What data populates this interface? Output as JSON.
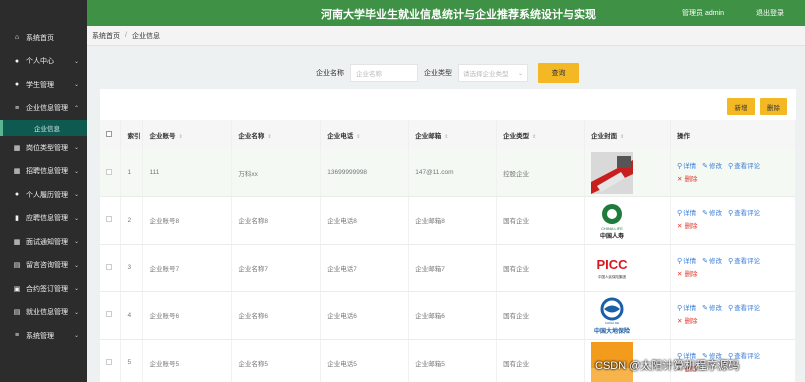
{
  "header": {
    "title": "河南大学毕业生就业信息统计与企业推荐系统设计与实现",
    "user": "管理员 admin",
    "logout": "退出登录",
    "color": "#3e9145"
  },
  "sidebar": {
    "items": [
      {
        "label": "系统首页",
        "icon": "home-icon"
      },
      {
        "label": "个人中心",
        "icon": "user-icon"
      },
      {
        "label": "学生管理",
        "icon": "user-icon"
      },
      {
        "label": "企业信息管理",
        "icon": "list-icon"
      },
      {
        "label": "岗位类型管理",
        "icon": "grid-icon"
      },
      {
        "label": "招聘信息管理",
        "icon": "grid-icon"
      },
      {
        "label": "个人履历管理",
        "icon": "user-icon"
      },
      {
        "label": "应聘信息管理",
        "icon": "bar-chart-icon"
      },
      {
        "label": "面试通知管理",
        "icon": "grid-icon"
      },
      {
        "label": "留言咨询管理",
        "icon": "document-icon"
      },
      {
        "label": "合约签订管理",
        "icon": "print-icon"
      },
      {
        "label": "就业信息管理",
        "icon": "document-icon"
      },
      {
        "label": "系统管理",
        "icon": "list-icon"
      }
    ],
    "sub_item": "企业信息"
  },
  "breadcrumb": {
    "home": "系统首页",
    "current": "企业信息"
  },
  "search": {
    "name_label": "企业名称",
    "name_placeholder": "企业名称",
    "type_label": "企业类型",
    "type_placeholder": "请选择企业类型",
    "query_button": "查询"
  },
  "actions": {
    "add": "新增",
    "delete": "删除"
  },
  "table": {
    "headers": [
      "索引",
      "企业账号",
      "企业名称",
      "企业电话",
      "企业邮箱",
      "企业类型",
      "企业封面",
      "操作"
    ],
    "rows": [
      {
        "index": "1",
        "account": "111",
        "name": "万科xx",
        "phone": "13699999998",
        "email": "147@11.com",
        "type": "控股企业",
        "cover": "cover-red-logo"
      },
      {
        "index": "2",
        "account": "企业账号8",
        "name": "企业名称8",
        "phone": "企业电话8",
        "email": "企业邮箱8",
        "type": "国有企业",
        "cover": "cover-china-life"
      },
      {
        "index": "3",
        "account": "企业账号7",
        "name": "企业名称7",
        "phone": "企业电话7",
        "email": "企业邮箱7",
        "type": "国有企业",
        "cover": "cover-picc"
      },
      {
        "index": "4",
        "account": "企业账号6",
        "name": "企业名称6",
        "phone": "企业电话6",
        "email": "企业邮箱6",
        "type": "国有企业",
        "cover": "cover-dadi"
      },
      {
        "index": "5",
        "account": "企业账号5",
        "name": "企业名称5",
        "phone": "企业电话5",
        "email": "企业邮箱5",
        "type": "国有企业",
        "cover": "cover-orange"
      }
    ],
    "op_detail": "详情",
    "op_edit": "修改",
    "op_review": "查看评论",
    "op_delete": "删除"
  },
  "covers": {
    "china_life_line1": "CHINA LIFE",
    "china_life_line2": "中国人寿",
    "picc_line1": "PICC",
    "picc_line2": "中国人民保险集团",
    "dadi_line1": "CHINA RE",
    "dadi_line2": "中国大地保险"
  },
  "watermark": "CSDN @太阳计算机程序源码"
}
